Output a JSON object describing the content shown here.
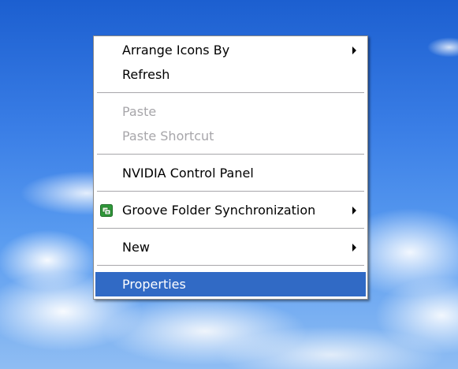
{
  "context_menu": {
    "items": [
      {
        "label": "Arrange Icons By",
        "submenu": true,
        "enabled": true
      },
      {
        "label": "Refresh",
        "submenu": false,
        "enabled": true
      },
      {
        "label": "Paste",
        "submenu": false,
        "enabled": false
      },
      {
        "label": "Paste Shortcut",
        "submenu": false,
        "enabled": false
      },
      {
        "label": "NVIDIA Control Panel",
        "submenu": false,
        "enabled": true
      },
      {
        "label": "Groove Folder Synchronization",
        "submenu": true,
        "enabled": true,
        "icon": "groove-icon"
      },
      {
        "label": "New",
        "submenu": true,
        "enabled": true
      },
      {
        "label": "Properties",
        "submenu": false,
        "enabled": true,
        "highlighted": true
      }
    ]
  },
  "colors": {
    "highlight": "#316ac5",
    "disabled_text": "#a7a6aa",
    "desktop_sky": "#3a7ee6"
  }
}
